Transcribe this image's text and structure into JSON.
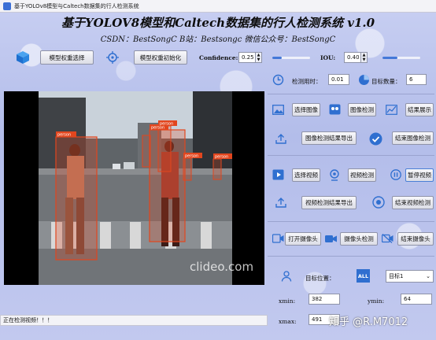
{
  "window": {
    "title": "基于YOLOv8模型与Caltech数据集的行人检测系统"
  },
  "header": {
    "title": "基于YOLOV8模型和Caltech数据集的行人检测系统 v1.0",
    "subtitle": "CSDN：BestSongC   B站：Bestsongc   微信公众号：BestSongC"
  },
  "toolbar": {
    "select_weights": "模型权重选择",
    "init_weights": "模型权重初始化",
    "confidence_label": "Confidence:",
    "confidence_value": "0.25",
    "confidence_level": 0.25,
    "iou_label": "IOU:",
    "iou_value": "0.40",
    "iou_level": 0.4
  },
  "stats": {
    "time_label": "检测用时：",
    "time_value": "0.01",
    "count_label": "目标数量：",
    "count_value": "6"
  },
  "image_section": {
    "select_image": "选择图像",
    "detect_image": "图像检测",
    "show_result": "结果展示",
    "export_image_result": "图像检测结果导出",
    "end_image_detect": "结束图像检测"
  },
  "video_section": {
    "select_video": "选择视频",
    "detect_video": "视频检测",
    "pause_video": "暂停视频",
    "export_video_result": "视频检测结果导出",
    "end_video_detect": "结束视频检测"
  },
  "camera_section": {
    "open_camera": "打开摄像头",
    "camera_detect": "摄像头检测",
    "close_camera": "结束摄像头"
  },
  "target_section": {
    "position_label": "目标位置：",
    "all_badge": "ALL",
    "target_select": "目标1",
    "xmin_label": "xmin:",
    "xmin_value": "382",
    "ymin_label": "ymin:",
    "ymin_value": "64",
    "xmax_label": "xmax:",
    "xmax_value": "491"
  },
  "video_view": {
    "person_label": "person",
    "watermark": "clideo.com",
    "box_color": "#e2461e"
  },
  "status": {
    "text": "正在检测视频！！！"
  },
  "site_watermark": "知乎 @R.M7012"
}
